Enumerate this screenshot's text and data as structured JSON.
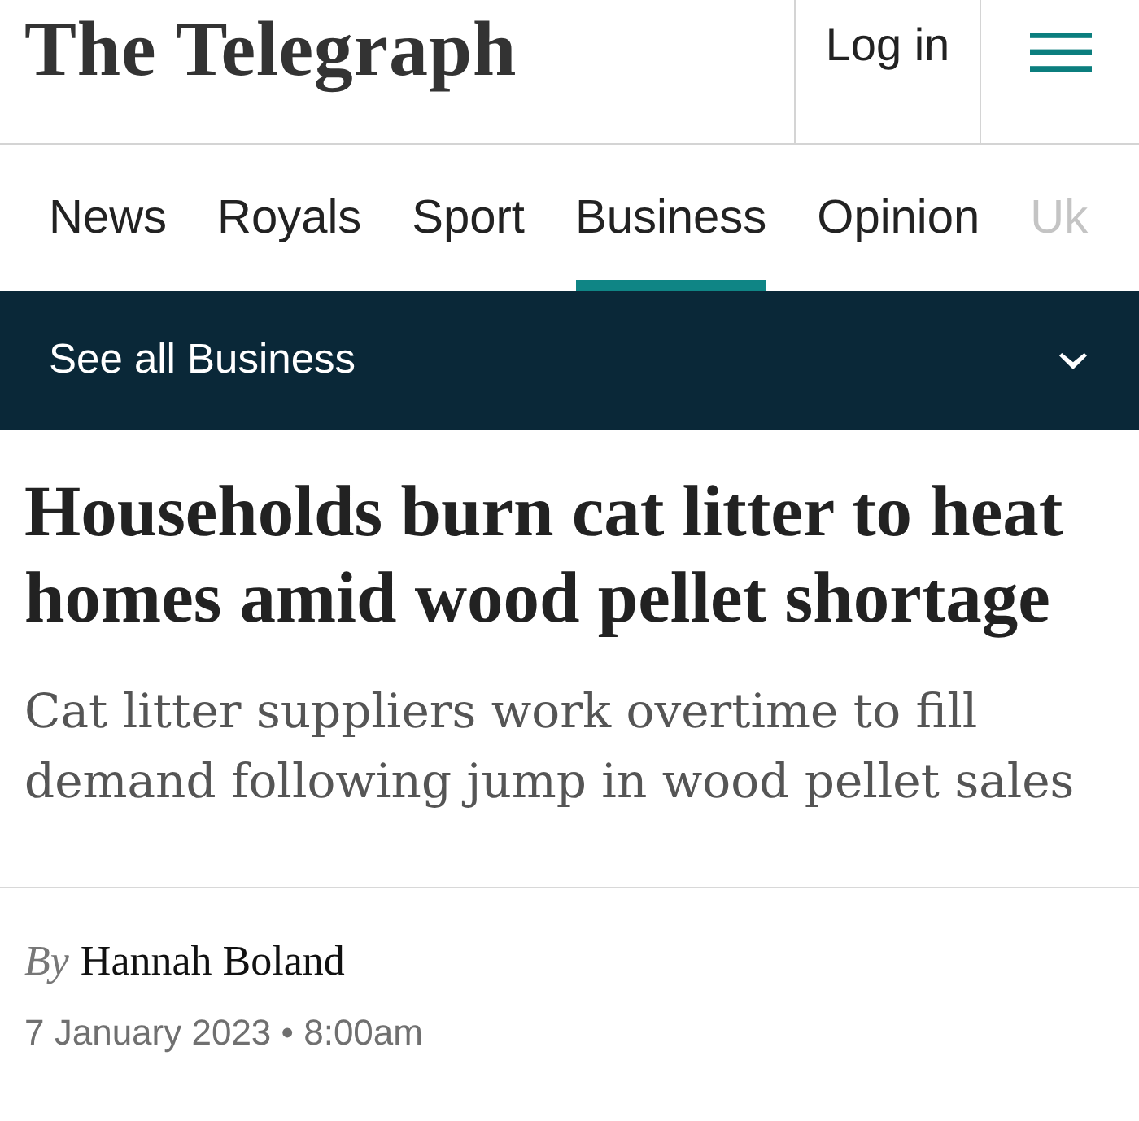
{
  "header": {
    "logo": "The Telegraph",
    "login": "Log in"
  },
  "tabs": [
    {
      "label": "News",
      "selected": false,
      "faded": false
    },
    {
      "label": "Royals",
      "selected": false,
      "faded": false
    },
    {
      "label": "Sport",
      "selected": false,
      "faded": false
    },
    {
      "label": "Business",
      "selected": true,
      "faded": false
    },
    {
      "label": "Opinion",
      "selected": false,
      "faded": false
    },
    {
      "label": "Uk",
      "selected": false,
      "faded": true
    }
  ],
  "section_menu": {
    "label": "See all Business",
    "expanded": false
  },
  "article": {
    "headline": "Households burn cat litter to heat homes amid wood pellet shortage",
    "standfirst": "Cat litter suppliers work overtime to fill demand following jump in wood pellet sales",
    "byline": {
      "prefix": "By",
      "author": "Hannah Boland"
    },
    "date": "7 January 2023 • 8:00am"
  }
}
